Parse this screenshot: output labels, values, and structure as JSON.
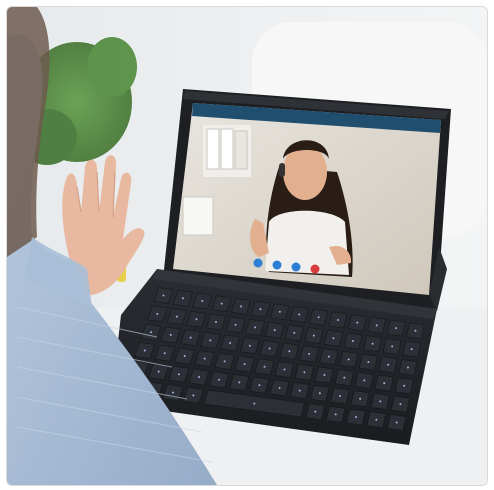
{
  "image": {
    "description_hidden": true,
    "colors": {
      "background": "#eef0f1",
      "plant": "#4f8a3a",
      "tablet_frame": "#1d1f22",
      "keyboard": "#23252a",
      "key": "#2c2f35",
      "key_legend": "#9fb2d8",
      "call_end": "#d93a3a",
      "call_button": "#2d7fd6",
      "sweater": "#a9bfd7",
      "skin": "#e8b9a0",
      "hair_dark": "#2a1d16",
      "shirt": "#f2f0ec"
    },
    "icons": [
      "video-call-buttons",
      "mic-icon",
      "camera-icon",
      "hangup-icon"
    ]
  }
}
